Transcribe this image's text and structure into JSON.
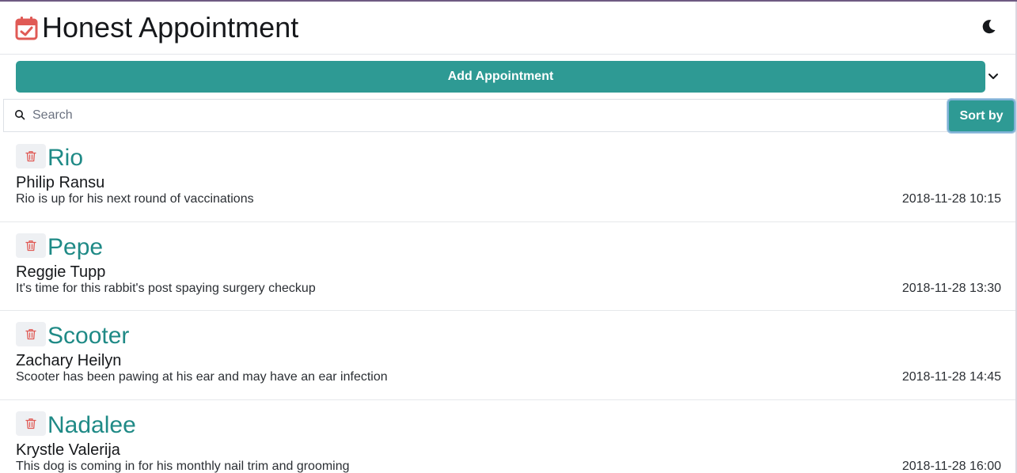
{
  "header": {
    "title": "Honest Appointment",
    "icons": {
      "logo": "calendar-check-icon",
      "theme": "moon-icon"
    }
  },
  "add": {
    "label": "Add Appointment"
  },
  "search": {
    "placeholder": "Search",
    "value": ""
  },
  "sort": {
    "label": "Sort by"
  },
  "colors": {
    "accent": "#2e9a94",
    "pet_name": "#1f8a86",
    "logo": "#e05a55",
    "delete": "#e05a55"
  },
  "appointments": [
    {
      "pet": "Rio",
      "owner": "Philip Ransu",
      "notes": "Rio is up for his next round of vaccinations",
      "date": "2018-11-28 10:15"
    },
    {
      "pet": "Pepe",
      "owner": "Reggie Tupp",
      "notes": "It's time for this rabbit's post spaying surgery checkup",
      "date": "2018-11-28 13:30"
    },
    {
      "pet": "Scooter",
      "owner": "Zachary Heilyn",
      "notes": "Scooter has been pawing at his ear and may have an ear infection",
      "date": "2018-11-28 14:45"
    },
    {
      "pet": "Nadalee",
      "owner": "Krystle Valerija",
      "notes": "This dog is coming in for his monthly nail trim and grooming",
      "date": "2018-11-28 16:00"
    }
  ]
}
